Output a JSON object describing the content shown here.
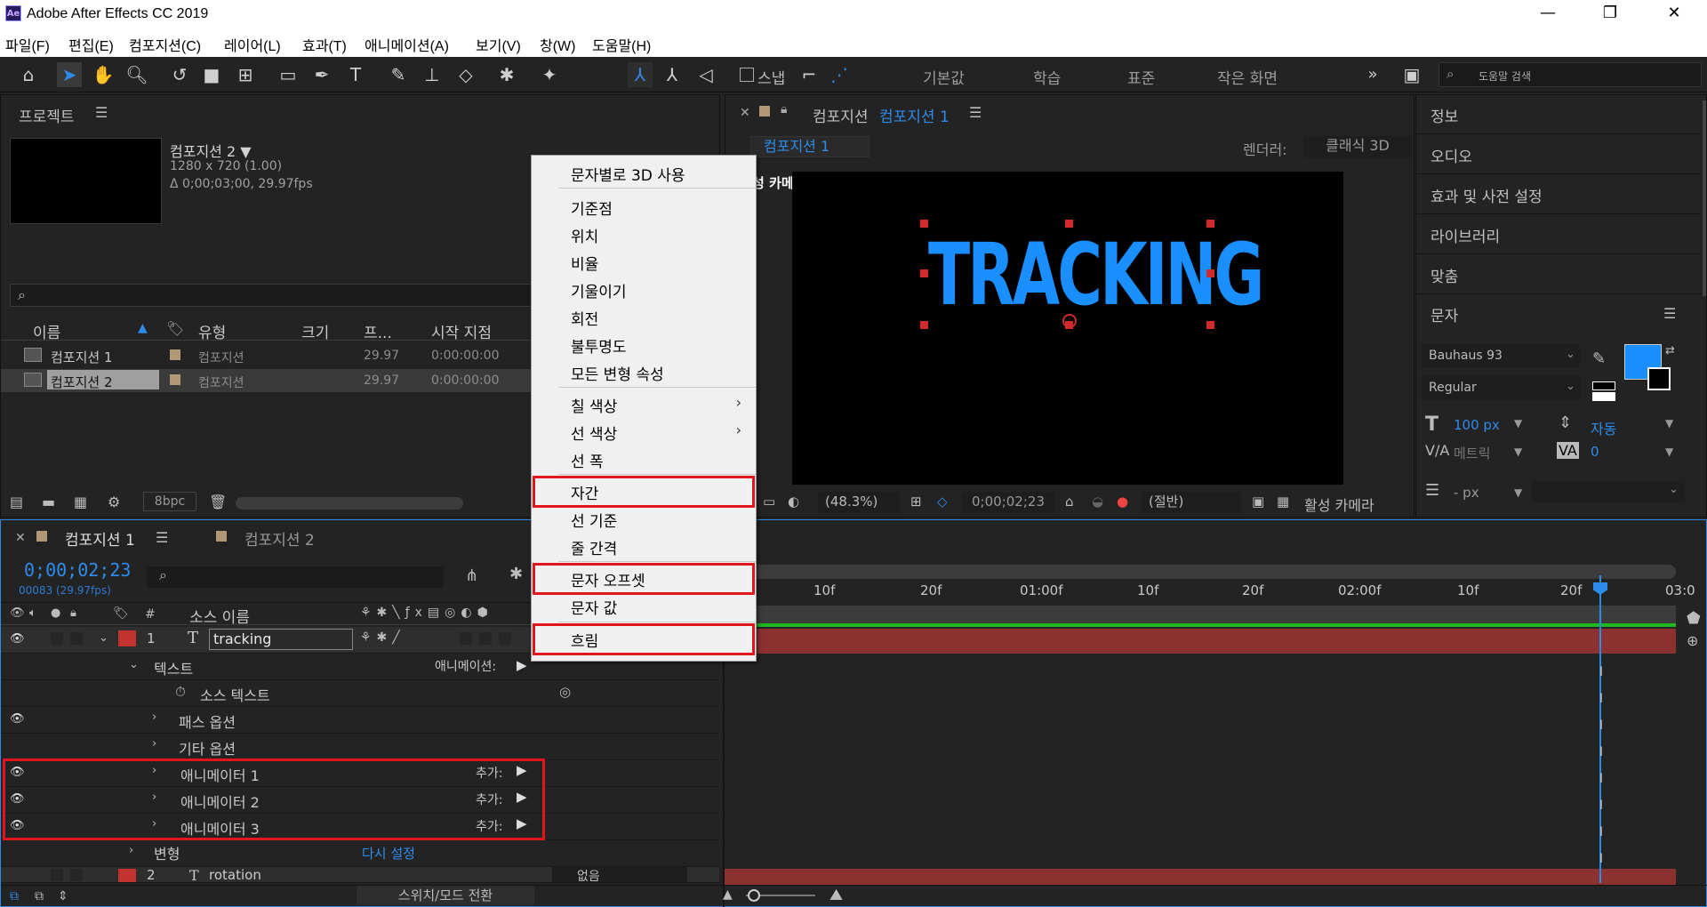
{
  "app": {
    "logo": "Ae",
    "title": "Adobe After Effects CC 2019"
  },
  "menu": [
    "파일(F)",
    "편집(E)",
    "컴포지션(C)",
    "레이어(L)",
    "효과(T)",
    "애니메이션(A)",
    "보기(V)",
    "창(W)",
    "도움말(H)"
  ],
  "toolbar": {
    "snap_label": "스냅",
    "workspaces": [
      "기본값",
      "학습",
      "표준",
      "작은 화면"
    ],
    "search_placeholder": "도움말 검색"
  },
  "project": {
    "tab": "프로젝트",
    "comp_name": "컴포지션 2 ▼",
    "comp_size": "1280 x 720 (1.00)",
    "comp_dur": "Δ 0;00;03;00, 29.97fps",
    "columns": [
      "이름",
      "유형",
      "크기",
      "프...",
      "시작 지점"
    ],
    "rows": [
      {
        "name": "컴포지션 1",
        "type": "컴포지션",
        "fps": "29.97",
        "start": "0:00:00:00"
      },
      {
        "name": "컴포지션 2",
        "type": "컴포지션",
        "fps": "29.97",
        "start": "0:00:00:00"
      }
    ],
    "bpc": "8bpc"
  },
  "viewer": {
    "tab_prefix": "컴포지션",
    "tab_name": "컴포지션 1",
    "subtab": "컴포지션 1",
    "renderer_label": "렌더러:",
    "renderer": "클래식 3D",
    "camera_label": "성 카메라",
    "text": "TRACKING",
    "zoom": "(48.3%)",
    "timecode": "0;00;02;23",
    "resolution": "(절반)",
    "active_camera": "활성 카메라"
  },
  "right_panel": {
    "items": [
      "정보",
      "오디오",
      "효과 및 사전 설정",
      "라이브러리",
      "맞춤"
    ],
    "char_title": "문자",
    "font": "Bauhaus 93",
    "style": "Regular",
    "size": "100 px",
    "leading": "자동",
    "kerning": "메트릭",
    "tracking": "0",
    "stroke": "- px",
    "fill_color": "#1a8fff"
  },
  "timeline": {
    "tab1": "컴포지션 1",
    "tab2": "컴포지션 2",
    "timecode": "0;00;02;23",
    "frames": "00083 (29.97fps)",
    "source_name_col": "소스 이름",
    "layer1": {
      "num": "1",
      "name": "tracking"
    },
    "layer2": {
      "num": "2",
      "name": "rotation",
      "mode": "없음"
    },
    "props": {
      "text": "텍스트",
      "animate": "애니메이션:",
      "source_text": "소스 텍스트",
      "path_options": "패스 옵션",
      "more_options": "기타 옵션",
      "animator1": "애니메이터 1",
      "animator2": "애니메이터 2",
      "animator3": "애니메이터 3",
      "add": "추가:",
      "transform": "변형",
      "reset": "다시 설정"
    },
    "ticks": [
      "10f",
      "20f",
      "01:00f",
      "10f",
      "20f",
      "02:00f",
      "10f",
      "20f",
      "03:0"
    ],
    "switch_mode": "스위치/모드 전환"
  },
  "context_menu": {
    "items": [
      "문자별로 3D 사용",
      "기준점",
      "위치",
      "비율",
      "기울이기",
      "회전",
      "불투명도",
      "모든 변형 속성",
      "칠 색상",
      "선 색상",
      "선 폭",
      "자간",
      "선 기준",
      "줄 간격",
      "문자 오프셋",
      "문자 값",
      "흐림"
    ]
  }
}
